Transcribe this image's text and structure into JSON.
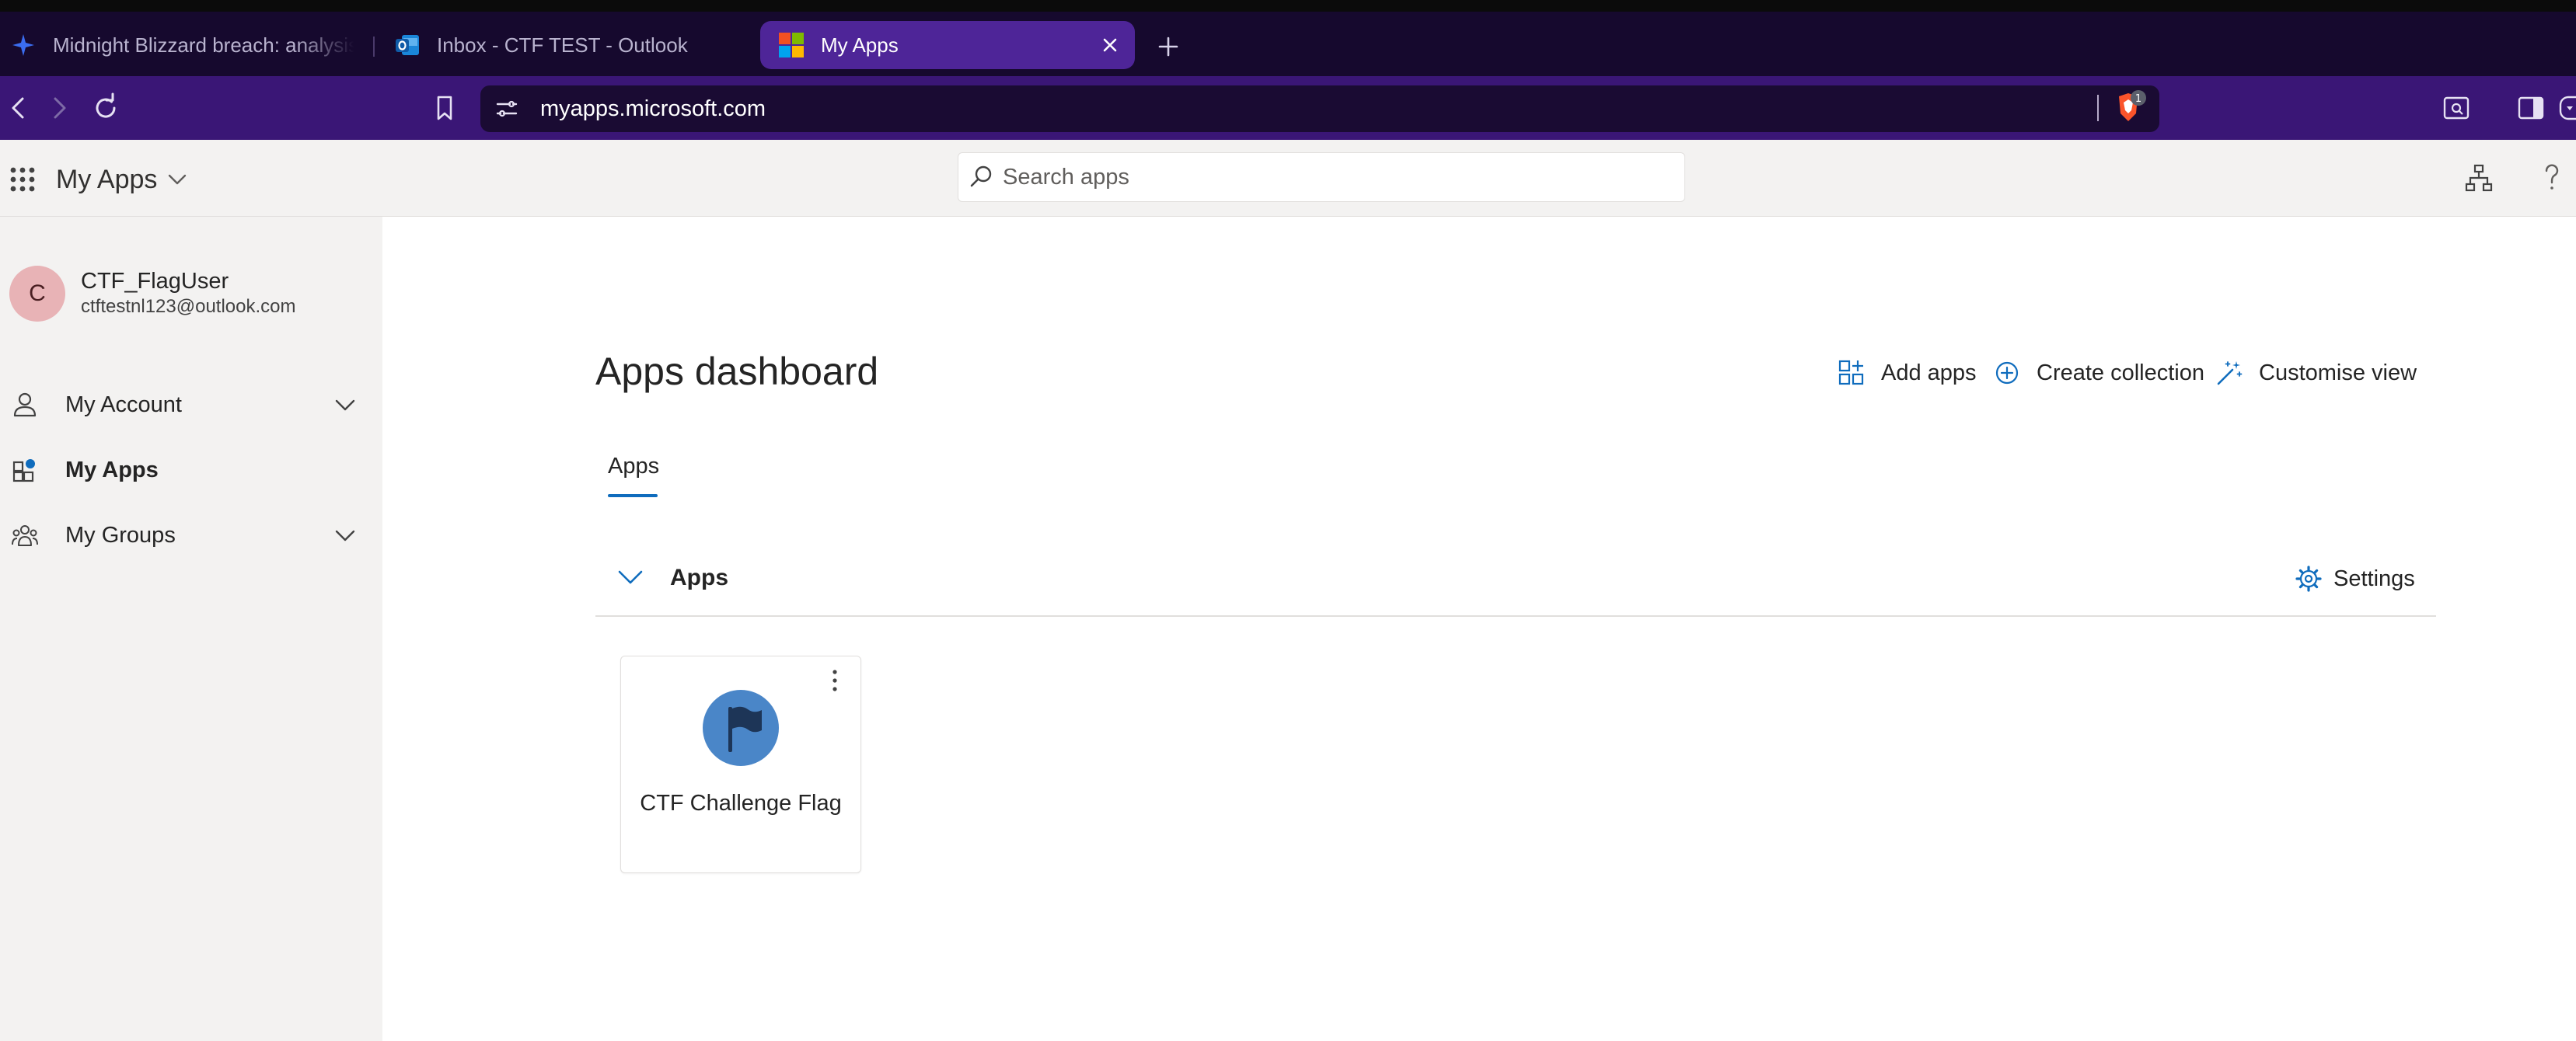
{
  "browser": {
    "tabs": [
      {
        "title": "Midnight Blizzard breach: analysis",
        "icon": "sparkle-icon"
      },
      {
        "title": "Inbox - CTF TEST - Outlook",
        "icon": "outlook-icon"
      },
      {
        "title": "My Apps",
        "icon": "microsoft-logo-icon",
        "active": true
      }
    ],
    "url": "myapps.microsoft.com",
    "shield_badge": "1",
    "colors": {
      "tab_bar": "#16092e",
      "active_tab": "#4e2598",
      "toolbar": "#3a1676"
    }
  },
  "header": {
    "app_title": "My Apps",
    "search_placeholder": "Search apps",
    "icons": [
      "app-launcher-icon",
      "org-chart-icon",
      "help-icon"
    ]
  },
  "sidebar": {
    "user": {
      "initial": "C",
      "name": "CTF_FlagUser",
      "email": "ctftestnl123@outlook.com",
      "avatar_color": "#e8b3b6"
    },
    "items": [
      {
        "label": "My Account",
        "icon": "person-icon",
        "expandable": true
      },
      {
        "label": "My Apps",
        "icon": "apps-icon",
        "active": true
      },
      {
        "label": "My Groups",
        "icon": "people-icon",
        "expandable": true
      }
    ]
  },
  "main": {
    "title": "Apps dashboard",
    "actions": {
      "add_apps": "Add apps",
      "create_collection": "Create collection",
      "customise_view": "Customise view"
    },
    "tabs": [
      {
        "label": "Apps",
        "active": true
      }
    ],
    "collection": {
      "title": "Apps",
      "settings_label": "Settings",
      "apps": [
        {
          "name": "CTF Challenge Flag",
          "icon": "flag-icon"
        }
      ]
    },
    "accent_color": "#0f6cbd"
  }
}
